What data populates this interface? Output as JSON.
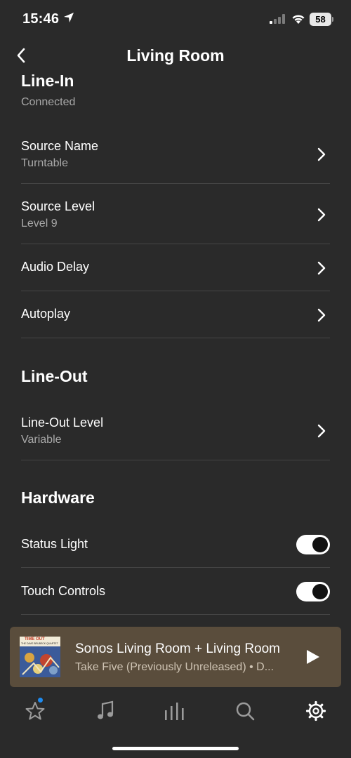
{
  "status_bar": {
    "time": "15:46",
    "battery": "58"
  },
  "nav": {
    "title": "Living Room"
  },
  "line_in": {
    "title": "Line-In",
    "status": "Connected",
    "rows": [
      {
        "label": "Source Name",
        "value": "Turntable"
      },
      {
        "label": "Source Level",
        "value": "Level 9"
      },
      {
        "label": "Audio Delay"
      },
      {
        "label": "Autoplay"
      }
    ]
  },
  "line_out": {
    "title": "Line-Out",
    "rows": [
      {
        "label": "Line-Out Level",
        "value": "Variable"
      }
    ]
  },
  "hardware": {
    "title": "Hardware",
    "rows": [
      {
        "label": "Status Light",
        "toggle_on": true
      },
      {
        "label": "Touch Controls",
        "toggle_on": true
      }
    ]
  },
  "now_playing": {
    "room": "Sonos Living Room + Living Room",
    "track": "Take Five (Previously Unreleased) • D...",
    "album_art_text": "TIME OUT",
    "album_art_artist": "THE DAVE BRUBECK QUARTET"
  },
  "tabs": [
    {
      "name": "favorites-icon",
      "badge": true
    },
    {
      "name": "music-icon"
    },
    {
      "name": "rooms-icon"
    },
    {
      "name": "search-icon"
    },
    {
      "name": "settings-icon",
      "active": true
    }
  ],
  "colors": {
    "background": "#2a2a2a",
    "player_bg": "#5a4d3c",
    "divider": "#454545",
    "subtext": "#a9a9a9",
    "badge": "#1e8bf0"
  }
}
